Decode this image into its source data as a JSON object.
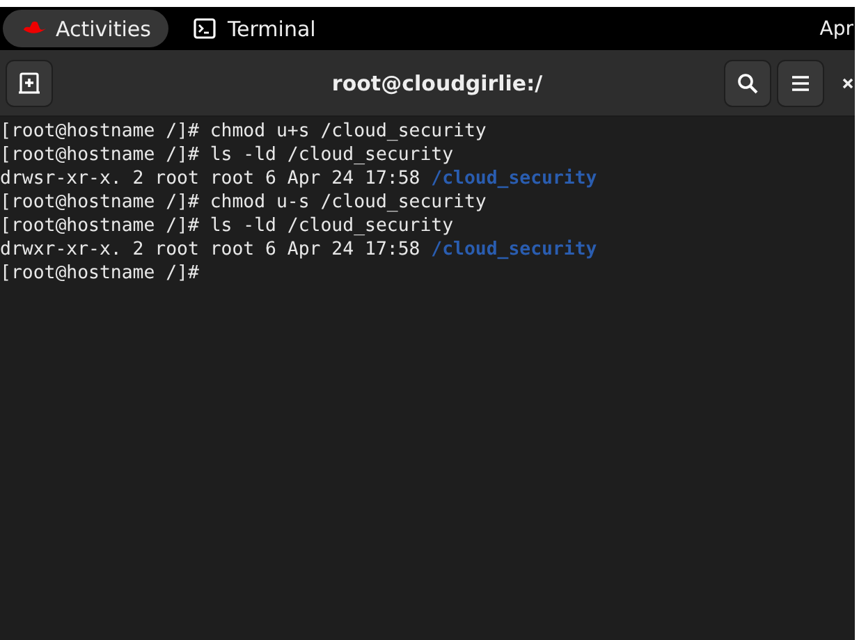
{
  "top_bar": {
    "activities": "Activities",
    "app": "Terminal",
    "clock": "Apr"
  },
  "header": {
    "title": "root@cloudgirlie:/"
  },
  "lines": [
    {
      "kind": "command",
      "prompt": "[root@hostname /]#",
      "command": "chmod u+s /cloud_security"
    },
    {
      "kind": "command",
      "prompt": "[root@hostname /]#",
      "command": "ls -ld /cloud_security"
    },
    {
      "kind": "listing",
      "text": "drwsr-xr-x. 2 root root 6 Apr 24 17:58",
      "path": "/cloud_security"
    },
    {
      "kind": "command",
      "prompt": "[root@hostname /]#",
      "command": "chmod u-s /cloud_security"
    },
    {
      "kind": "command",
      "prompt": "[root@hostname /]#",
      "command": "ls -ld /cloud_security"
    },
    {
      "kind": "listing",
      "text": "drwxr-xr-x. 2 root root 6 Apr 24 17:58",
      "path": "/cloud_security"
    },
    {
      "kind": "command",
      "prompt": "[root@hostname /]#"
    }
  ]
}
